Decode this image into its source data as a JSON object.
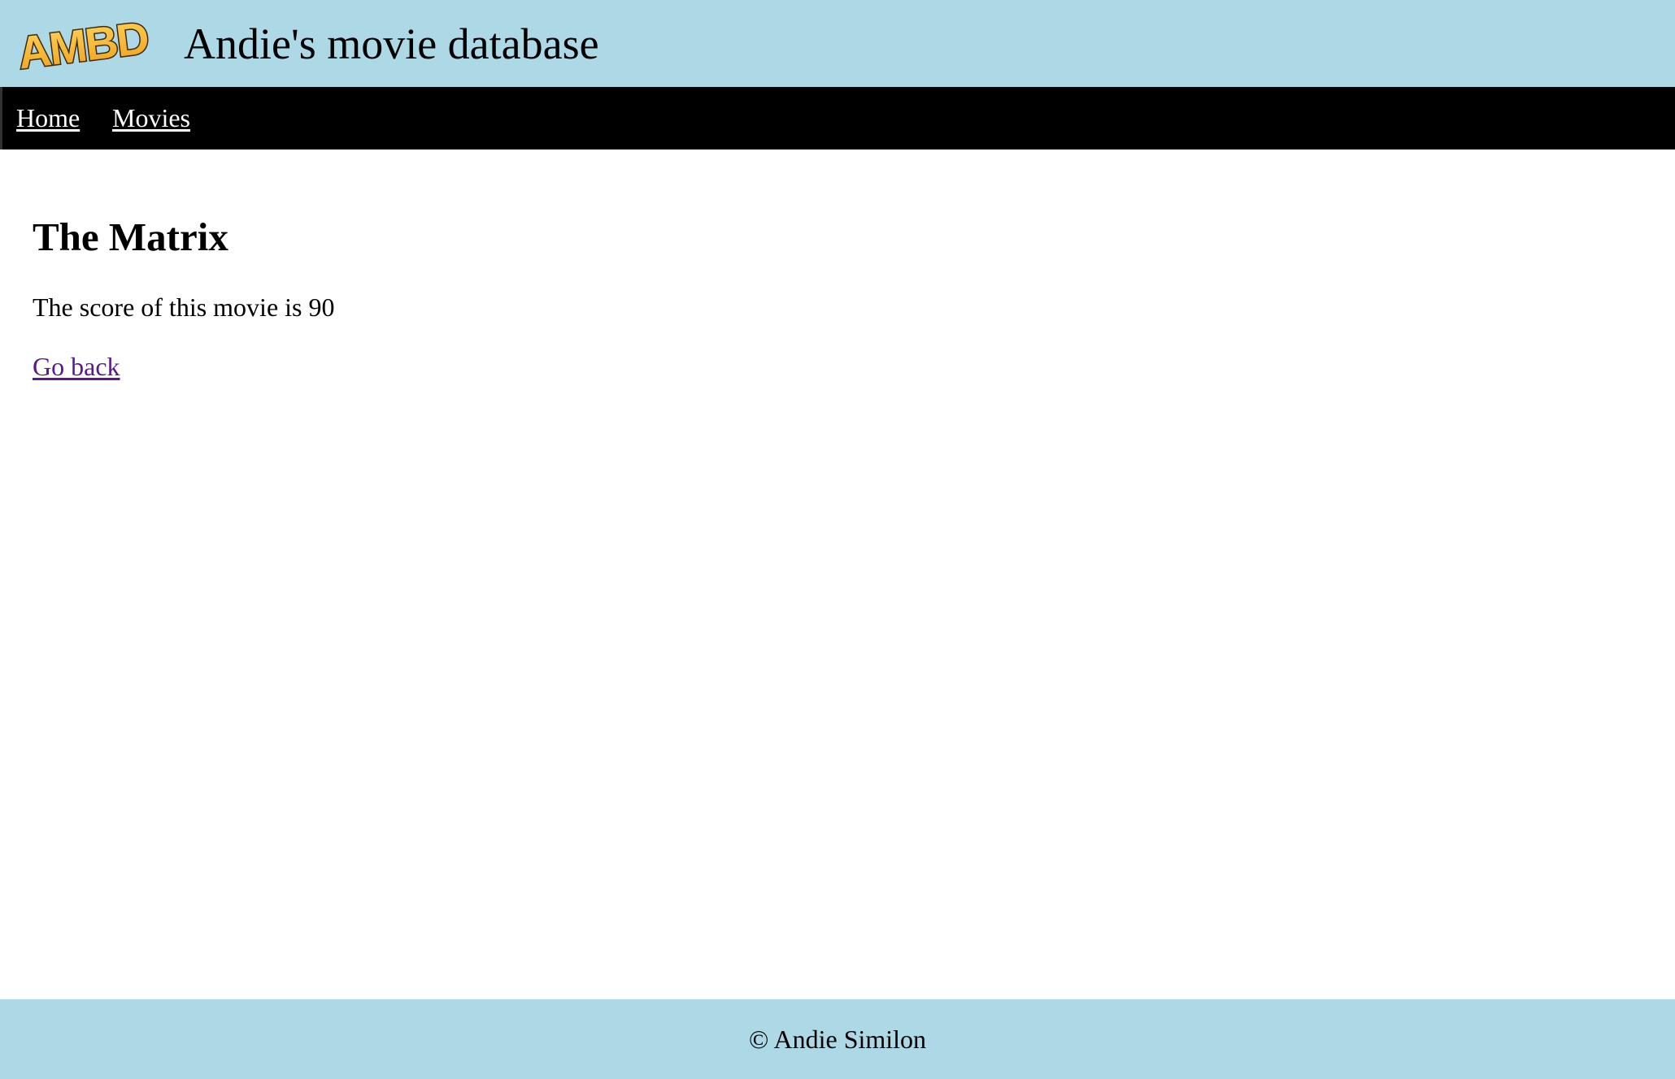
{
  "header": {
    "logo_text": "AMBD",
    "site_title": "Andie's movie database"
  },
  "nav": {
    "items": [
      {
        "label": "Home"
      },
      {
        "label": "Movies"
      }
    ]
  },
  "main": {
    "movie_title": "The Matrix",
    "score_text": "The score of this movie is 90",
    "back_link": "Go back"
  },
  "footer": {
    "text": "© Andie Similon"
  },
  "colors": {
    "header_bg": "#add8e6",
    "nav_bg": "#000000",
    "nav_link": "#ffffff",
    "visited_link": "#551a8b",
    "logo_fill": "#f6b426"
  }
}
